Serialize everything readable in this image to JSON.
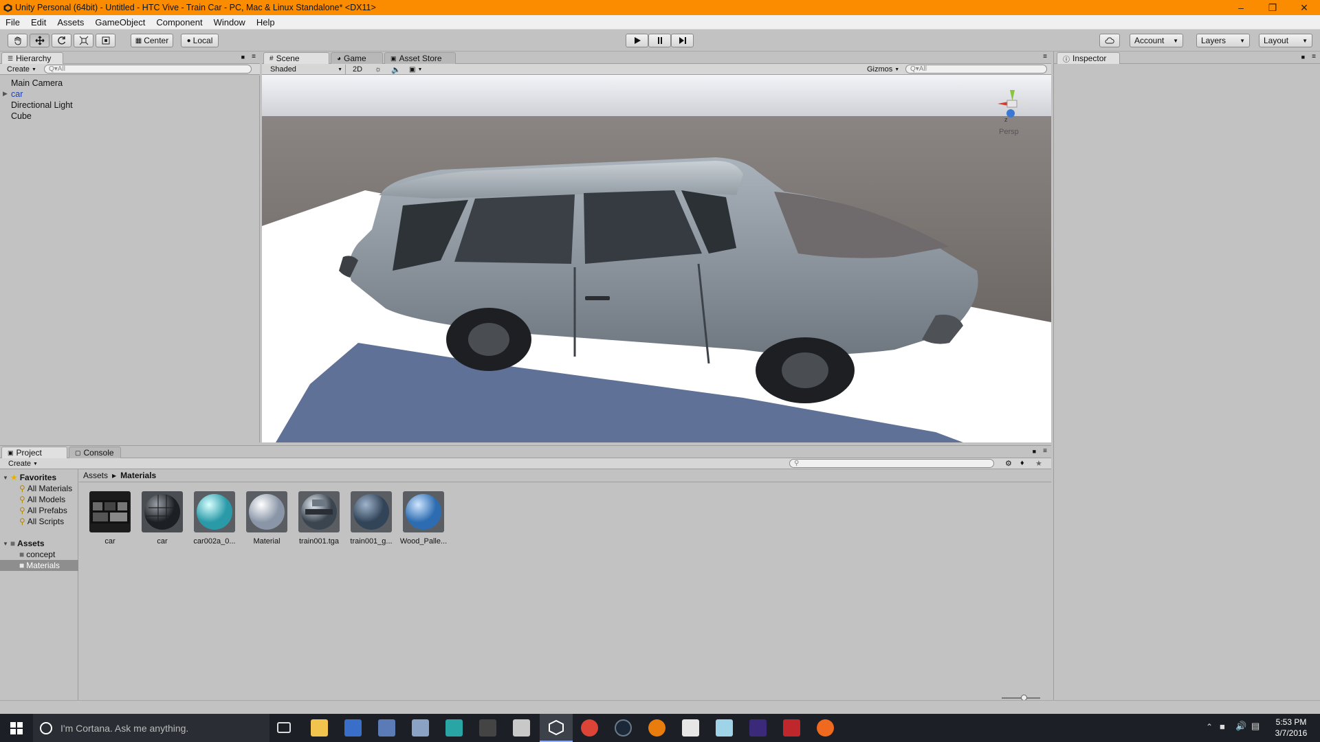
{
  "window": {
    "title": "Unity Personal (64bit) - Untitled - HTC Vive - Train Car - PC, Mac & Linux Standalone* <DX11>"
  },
  "menu": [
    "File",
    "Edit",
    "Assets",
    "GameObject",
    "Component",
    "Window",
    "Help"
  ],
  "toolbar": {
    "pivot_label": "Center",
    "space_label": "Local",
    "account_label": "Account",
    "layers_label": "Layers",
    "layout_label": "Layout"
  },
  "hierarchy": {
    "tab": "Hierarchy",
    "create_label": "Create",
    "search_placeholder": "Q▾All",
    "items": [
      {
        "label": "Main Camera"
      },
      {
        "label": "car",
        "expandable": true,
        "selected_color": "#1e3fb5"
      },
      {
        "label": "Directional Light"
      },
      {
        "label": "Cube"
      }
    ]
  },
  "scene_tabs": [
    "Scene",
    "Game",
    "Asset Store"
  ],
  "scene_bar": {
    "shading": "Shaded",
    "mode_2d": "2D",
    "gizmos": "Gizmos",
    "search_placeholder": "Q▾All"
  },
  "gizmo": {
    "label": "Persp",
    "axis": "z"
  },
  "inspector": {
    "tab": "Inspector"
  },
  "project": {
    "tabs": [
      "Project",
      "Console"
    ],
    "create_label": "Create",
    "breadcrumb": [
      "Assets",
      "Materials"
    ],
    "favorites_label": "Favorites",
    "favorites": [
      "All Materials",
      "All Models",
      "All Prefabs",
      "All Scripts"
    ],
    "assets_label": "Assets",
    "folders": [
      "concept",
      "Materials"
    ],
    "selected_folder": "Materials",
    "items": [
      {
        "label": "car",
        "kind": "texture"
      },
      {
        "label": "car",
        "kind": "dark-sphere"
      },
      {
        "label": "car002a_0...",
        "kind": "cyan-sphere"
      },
      {
        "label": "Material",
        "kind": "white-sphere"
      },
      {
        "label": "train001.tga",
        "kind": "train-sphere"
      },
      {
        "label": "train001_g...",
        "kind": "blue-grey-sphere"
      },
      {
        "label": "Wood_Palle...",
        "kind": "blue-sphere"
      }
    ]
  },
  "taskbar": {
    "search_placeholder": "I'm Cortana. Ask me anything.",
    "time": "5:53 PM",
    "date": "3/7/2016"
  },
  "colors": {
    "titlebar": "#fb8c00",
    "panel": "#c2c2c2",
    "sky": "#e5e8ee",
    "ground": "#6b6560"
  }
}
